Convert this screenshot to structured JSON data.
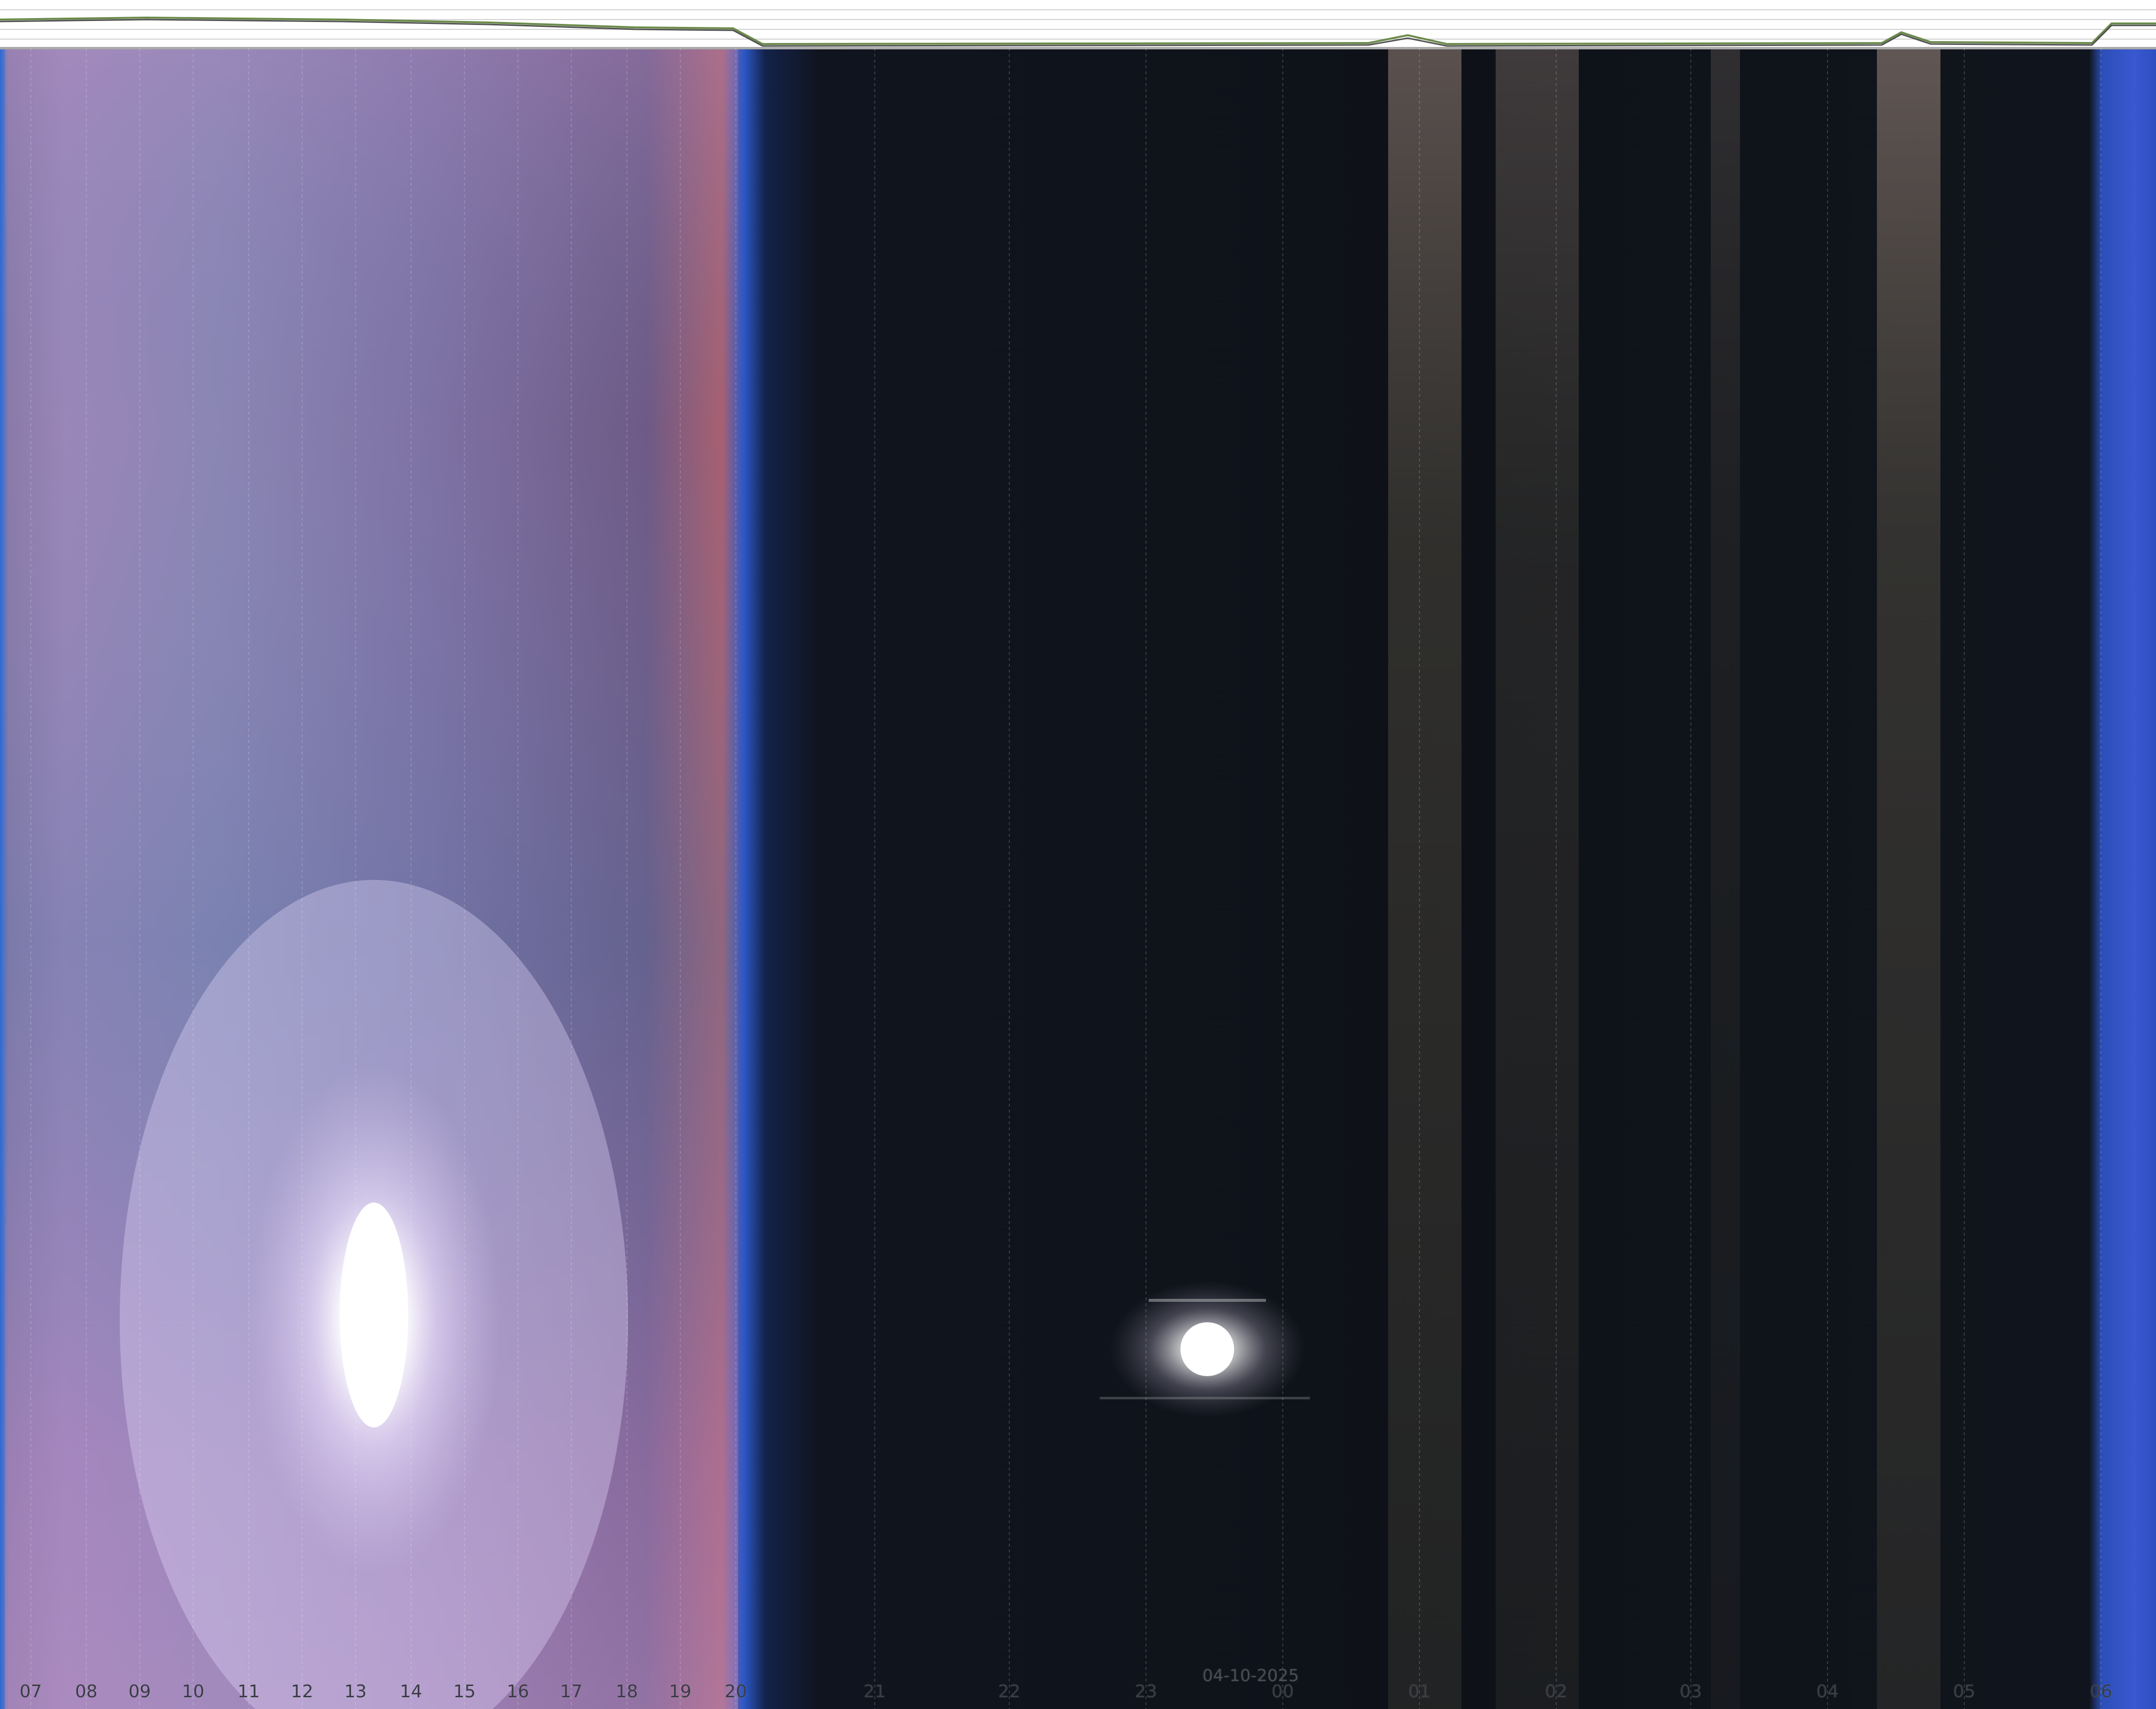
{
  "hours": [
    {
      "label": "07",
      "fraction": 0.0
    },
    {
      "label": "08",
      "fraction": 0.026
    },
    {
      "label": "09",
      "fraction": 0.051
    },
    {
      "label": "10",
      "fraction": 0.076
    },
    {
      "label": "11",
      "fraction": 0.102
    },
    {
      "label": "12",
      "fraction": 0.127
    },
    {
      "label": "13",
      "fraction": 0.152
    },
    {
      "label": "14",
      "fraction": 0.178
    },
    {
      "label": "15",
      "fraction": 0.203
    },
    {
      "label": "16",
      "fraction": 0.228
    },
    {
      "label": "17",
      "fraction": 0.253
    },
    {
      "label": "18",
      "fraction": 0.279
    },
    {
      "label": "19",
      "fraction": 0.304
    },
    {
      "label": "20",
      "fraction": 0.33
    },
    {
      "label": "21",
      "fraction": 0.395
    },
    {
      "label": "22",
      "fraction": 0.458
    },
    {
      "label": "23",
      "fraction": 0.522
    },
    {
      "label": "00",
      "fraction": 0.586
    },
    {
      "label": "01",
      "fraction": 0.65
    },
    {
      "label": "02",
      "fraction": 0.714
    },
    {
      "label": "03",
      "fraction": 0.777
    },
    {
      "label": "04",
      "fraction": 0.841
    },
    {
      "label": "05",
      "fraction": 0.905
    },
    {
      "label": "06",
      "fraction": 0.969
    }
  ],
  "date_label": "04-10-2025",
  "colors": {
    "day_sky": "#5a6aa0",
    "day_pink": "#9a78b0",
    "twilight_blue": "#2a4fc8",
    "night": "#0e1116",
    "streak": "#6a5e50",
    "sun": "#ffffff",
    "moon": "#ffffff"
  }
}
